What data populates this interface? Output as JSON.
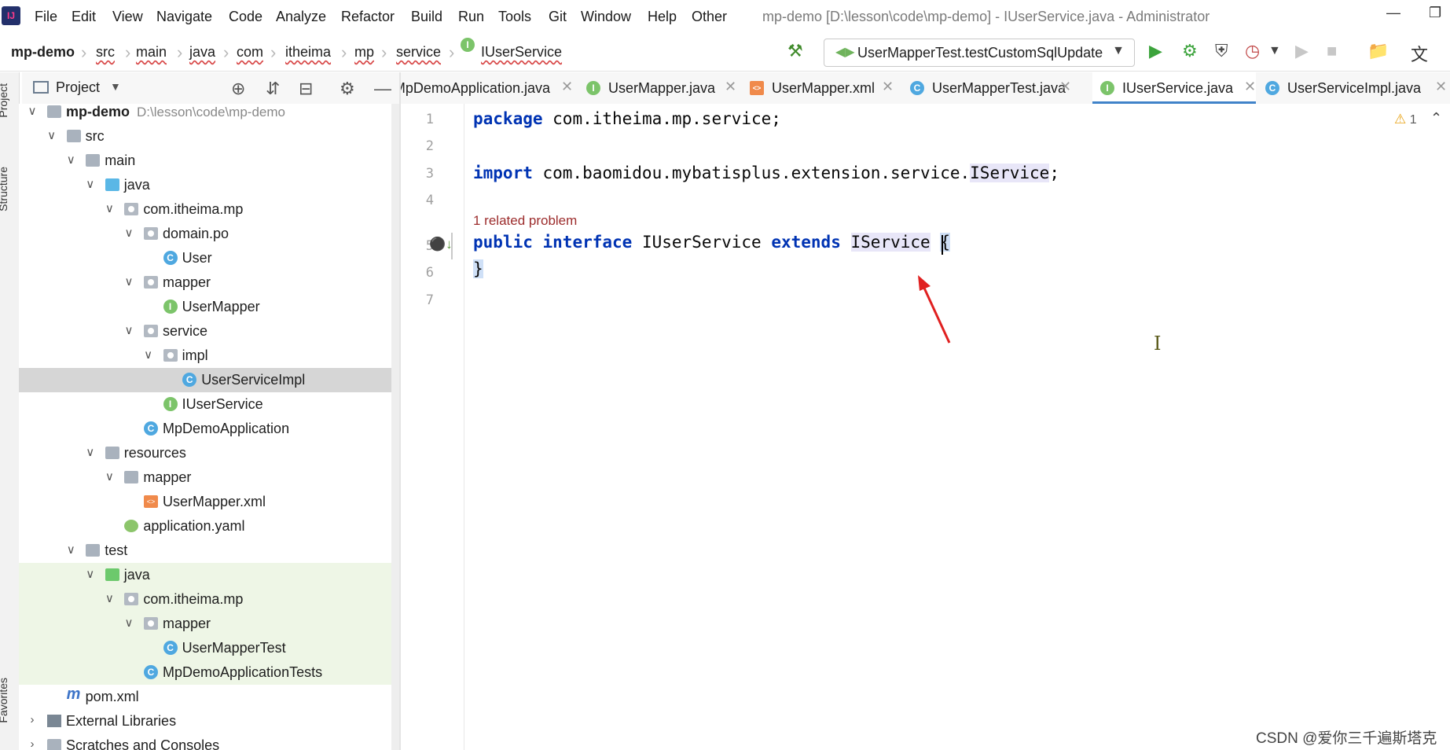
{
  "menubar": {
    "items": [
      "File",
      "Edit",
      "View",
      "Navigate",
      "Code",
      "Analyze",
      "Refactor",
      "Build",
      "Run",
      "Tools",
      "Git",
      "Window",
      "Help",
      "Other"
    ],
    "window_title": "mp-demo [D:\\lesson\\code\\mp-demo] - IUserService.java - Administrator"
  },
  "breadcrumb": {
    "items": [
      "mp-demo",
      "src",
      "main",
      "java",
      "com",
      "itheima",
      "mp",
      "service",
      "IUserService"
    ]
  },
  "toolbar": {
    "run_config": "UserMapperTest.testCustomSqlUpdate"
  },
  "project_panel": {
    "title": "Project",
    "tree": [
      {
        "label": "mp-demo",
        "path": "D:\\lesson\\code\\mp-demo",
        "depth": 0,
        "icon": "folder",
        "expanded": true,
        "bold": true
      },
      {
        "label": "src",
        "depth": 1,
        "icon": "folder",
        "expanded": true
      },
      {
        "label": "main",
        "depth": 2,
        "icon": "folder",
        "expanded": true
      },
      {
        "label": "java",
        "depth": 3,
        "icon": "folder-blue",
        "expanded": true
      },
      {
        "label": "com.itheima.mp",
        "depth": 4,
        "icon": "package",
        "expanded": true
      },
      {
        "label": "domain.po",
        "depth": 5,
        "icon": "package",
        "expanded": true
      },
      {
        "label": "User",
        "depth": 6,
        "icon": "class"
      },
      {
        "label": "mapper",
        "depth": 5,
        "icon": "package",
        "expanded": true
      },
      {
        "label": "UserMapper",
        "depth": 6,
        "icon": "interface"
      },
      {
        "label": "service",
        "depth": 5,
        "icon": "package",
        "expanded": true
      },
      {
        "label": "impl",
        "depth": 6,
        "icon": "package",
        "expanded": true
      },
      {
        "label": "UserServiceImpl",
        "depth": 7,
        "icon": "class",
        "selected": true
      },
      {
        "label": "IUserService",
        "depth": 6,
        "icon": "interface"
      },
      {
        "label": "MpDemoApplication",
        "depth": 5,
        "icon": "class"
      },
      {
        "label": "resources",
        "depth": 3,
        "icon": "folder",
        "expanded": true
      },
      {
        "label": "mapper",
        "depth": 4,
        "icon": "folder",
        "expanded": true
      },
      {
        "label": "UserMapper.xml",
        "depth": 5,
        "icon": "xml"
      },
      {
        "label": "application.yaml",
        "depth": 4,
        "icon": "yaml"
      },
      {
        "label": "test",
        "depth": 2,
        "icon": "folder",
        "expanded": true
      },
      {
        "label": "java",
        "depth": 3,
        "icon": "folder-green",
        "expanded": true,
        "test": true
      },
      {
        "label": "com.itheima.mp",
        "depth": 4,
        "icon": "package",
        "expanded": true,
        "test": true
      },
      {
        "label": "mapper",
        "depth": 5,
        "icon": "package",
        "expanded": true,
        "test": true
      },
      {
        "label": "UserMapperTest",
        "depth": 6,
        "icon": "class",
        "test": true
      },
      {
        "label": "MpDemoApplicationTests",
        "depth": 5,
        "icon": "class",
        "test": true
      },
      {
        "label": "pom.xml",
        "depth": 1,
        "icon": "maven"
      },
      {
        "label": "External Libraries",
        "depth": 0,
        "icon": "libs",
        "expanded": false
      },
      {
        "label": "Scratches and Consoles",
        "depth": 0,
        "icon": "scratch",
        "expanded": false
      }
    ]
  },
  "left_stripe": {
    "labels": [
      "Project",
      "Structure",
      "Favorites"
    ]
  },
  "tabs": [
    {
      "label": "MpDemoApplication.java",
      "icon": "class"
    },
    {
      "label": "UserMapper.java",
      "icon": "interface"
    },
    {
      "label": "UserMapper.xml",
      "icon": "xml"
    },
    {
      "label": "UserMapperTest.java",
      "icon": "class"
    },
    {
      "label": "IUserService.java",
      "icon": "interface",
      "active": true
    },
    {
      "label": "UserServiceImpl.java",
      "icon": "class"
    }
  ],
  "editor": {
    "line_numbers": [
      "1",
      "2",
      "3",
      "4",
      "5",
      "6",
      "7"
    ],
    "line1": {
      "kw": "package",
      "rest": " com.itheima.mp.service;"
    },
    "line3": {
      "kw": "import",
      "pkg": " com.baomidou.mybatisplus.extension.service.",
      "cls": "IService",
      "end": ";"
    },
    "problem_hint": "1 related problem",
    "line5": {
      "kw1": "public",
      "kw2": "interface",
      "name": "IUserService",
      "kw3": "extends",
      "cls": "IService",
      "brace": "{"
    },
    "line6": "}",
    "warnings_count": "1"
  },
  "watermark": "CSDN @爱你三千遍斯塔克"
}
